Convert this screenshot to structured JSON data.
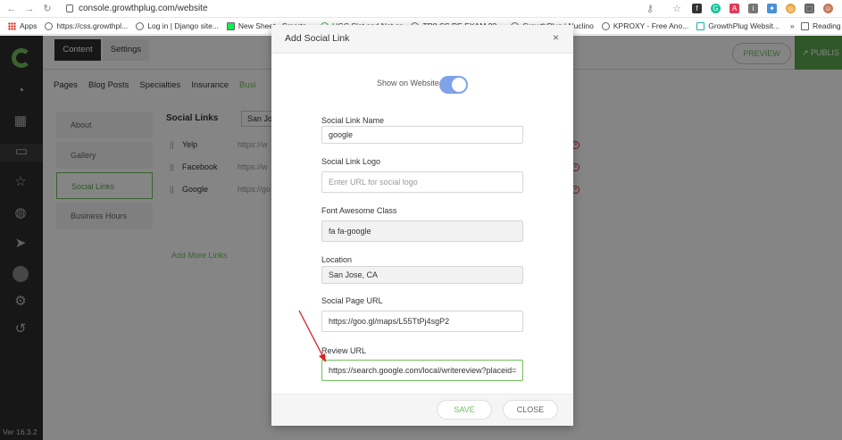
{
  "browser": {
    "url": "console.growthplug.com/website",
    "bookmarks": [
      {
        "label": "Apps"
      },
      {
        "label": "https://css.growthpl..."
      },
      {
        "label": "Log in | Django site..."
      },
      {
        "label": "New Sheet - Smarts..."
      },
      {
        "label": "UGC Slet and Net qs"
      },
      {
        "label": "TR8 CS RE EXAM ??..."
      },
      {
        "label": "GrowthPlug | Nuclino"
      },
      {
        "label": "KPROXY - Free Ano..."
      },
      {
        "label": "GrowthPlug Websit..."
      }
    ],
    "more": "»",
    "reading_list": "Reading li"
  },
  "app": {
    "version": "Ver 16.3.2",
    "tabs": {
      "content": "Content",
      "settings": "Settings"
    },
    "preview": "PREVIEW",
    "publish": "PUBLIS",
    "subnav": [
      "Pages",
      "Blog Posts",
      "Specialties",
      "Insurance",
      "Busi"
    ],
    "left_menu": [
      "About",
      "Gallery",
      "Social Links",
      "Business Hours"
    ],
    "social": {
      "title": "Social Links",
      "location_select": "San Jo",
      "rows": [
        {
          "name": "Yelp",
          "url": "https://w"
        },
        {
          "name": "Facebook",
          "url": "https://w"
        },
        {
          "name": "Google",
          "url": "https://go"
        }
      ],
      "add_more": "Add More Links"
    }
  },
  "modal": {
    "title": "Add Social Link",
    "close_icon": "×",
    "show_on_website": "Show on Website",
    "show_on_website_enabled": true,
    "fields": {
      "name_label": "Social Link Name",
      "name_value": "google",
      "logo_label": "Social Link Logo",
      "logo_placeholder": "Enter URL for social logo",
      "fa_label": "Font Awesome Class",
      "fa_value": "fa fa-google",
      "location_label": "Location",
      "location_value": "San Jose, CA",
      "page_url_label": "Social Page URL",
      "page_url_value": "https://goo.gl/maps/L55TtPj4sgP2",
      "review_url_label": "Review URL",
      "review_url_value": "https://search.google.com/local/writereview?placeid="
    },
    "save": "SAVE",
    "close": "CLOSE"
  },
  "colors": {
    "accent": "#6fbf5a",
    "toggle": "#7fa2e8",
    "annotation": "#e02020"
  }
}
